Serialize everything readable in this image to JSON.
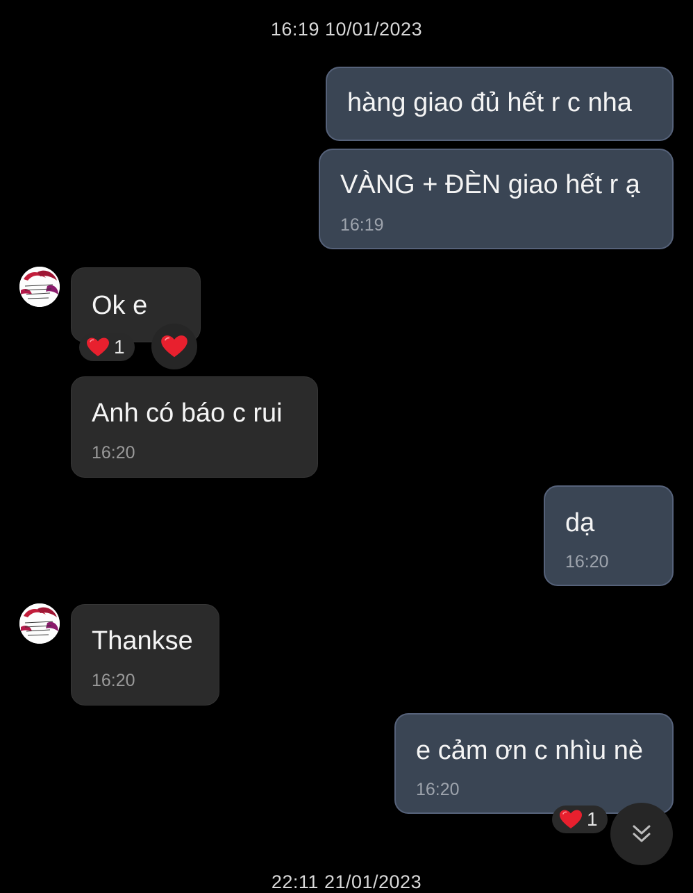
{
  "conversation": {
    "date_separator_top": "16:19 10/01/2023",
    "date_separator_bottom": "22:11 21/01/2023",
    "messages": [
      {
        "direction": "outgoing",
        "text": "hàng giao đủ hết r c nha",
        "time": ""
      },
      {
        "direction": "outgoing",
        "text": "VÀNG + ĐÈN giao hết r ạ",
        "time": "16:19"
      },
      {
        "direction": "incoming",
        "text": "Ok e",
        "time": "",
        "reaction": {
          "emoji": "heart-icon",
          "count": "1"
        }
      },
      {
        "direction": "incoming",
        "text": "Anh có báo c rui",
        "time": "16:20"
      },
      {
        "direction": "outgoing",
        "text": "dạ",
        "time": "16:20"
      },
      {
        "direction": "incoming",
        "text": "Thankse",
        "time": "16:20"
      },
      {
        "direction": "outgoing",
        "text": "e cảm ơn c nhìu nè",
        "time": "16:20",
        "reaction": {
          "emoji": "heart-icon",
          "count": "1"
        }
      }
    ]
  },
  "icons": {
    "reaction": "heart-icon",
    "scroll_down": "chevron-double-down-icon"
  },
  "colors": {
    "background": "#000000",
    "outgoing_bubble": "#3a4554",
    "incoming_bubble": "#2b2b2b",
    "heart": "#e8202e"
  }
}
